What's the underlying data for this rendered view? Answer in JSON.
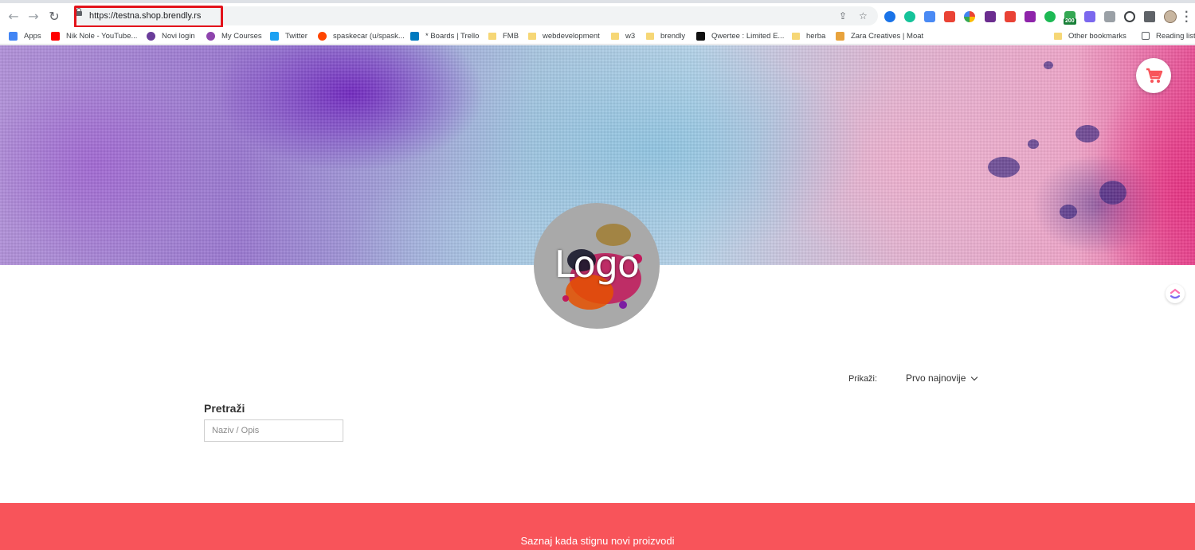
{
  "browser": {
    "url": "https://testna.shop.brendly.rs",
    "nav": {
      "back_icon": "←",
      "forward_icon": "→",
      "reload_icon": "↻"
    },
    "omnibox_icons": {
      "share_icon": "⇪",
      "star_icon": "☆"
    },
    "extension_badge": "200",
    "bookmarks": [
      {
        "label": "Apps",
        "icon": "apps-grid-icon",
        "color": "#4285f4"
      },
      {
        "label": "Nik Nole - YouTube...",
        "icon": "youtube-icon",
        "color": "#ff0000"
      },
      {
        "label": "Novi login",
        "icon": "site-icon",
        "color": "#6a3d9a"
      },
      {
        "label": "My Courses",
        "icon": "site-icon",
        "color": "#8e44ad"
      },
      {
        "label": "Twitter",
        "icon": "twitter-icon",
        "color": "#1da1f2"
      },
      {
        "label": "spaskecar (u/spask...",
        "icon": "reddit-icon",
        "color": "#ff4500"
      },
      {
        "label": "* Boards | Trello",
        "icon": "trello-icon",
        "color": "#0079bf"
      },
      {
        "label": "FMB",
        "icon": "folder-icon",
        "color": "#f6d776"
      },
      {
        "label": "webdevelopment",
        "icon": "folder-icon",
        "color": "#f6d776"
      },
      {
        "label": "w3",
        "icon": "folder-icon",
        "color": "#f6d776"
      },
      {
        "label": "brendly",
        "icon": "folder-icon",
        "color": "#f6d776"
      },
      {
        "label": "Qwertee : Limited E...",
        "icon": "qwertee-icon",
        "color": "#111111"
      },
      {
        "label": "herba",
        "icon": "folder-icon",
        "color": "#f6d776"
      },
      {
        "label": "Zara Creatives | Moat",
        "icon": "moat-icon",
        "color": "#e8a33d"
      },
      {
        "label": "Other bookmarks",
        "icon": "folder-icon",
        "color": "#f6d776"
      },
      {
        "label": "Reading list",
        "icon": "reading-list-icon",
        "color": "#5f6368"
      }
    ]
  },
  "shop": {
    "logo_text": "Logo",
    "sort": {
      "label": "Prikaži:",
      "selected": "Prvo najnovije"
    },
    "search": {
      "title": "Pretraži",
      "placeholder": "Naziv / Opis",
      "value": ""
    },
    "footer_text": "Saznaj kada stignu novi proizvodi",
    "colors": {
      "accent": "#f8545a",
      "cart_icon": "#f8545a"
    }
  }
}
